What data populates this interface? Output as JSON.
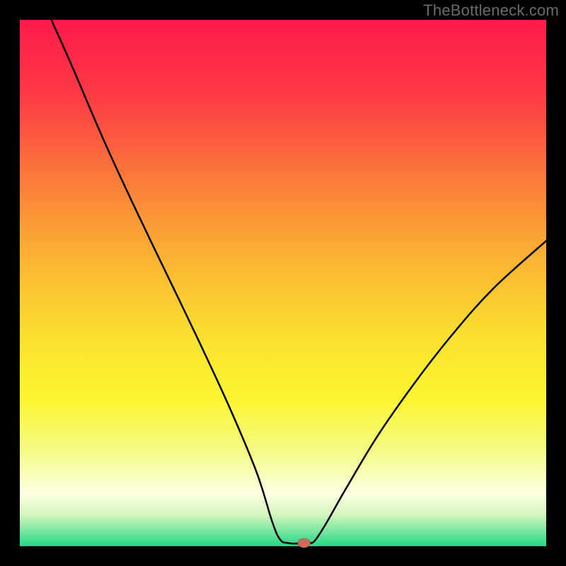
{
  "attribution": "TheBottleneck.com",
  "chart_data": {
    "type": "line",
    "title": "",
    "xlabel": "",
    "ylabel": "",
    "xlim": [
      0,
      100
    ],
    "ylim": [
      0,
      100
    ],
    "grid": false,
    "axes_visible": false,
    "background_gradient": {
      "stops": [
        {
          "pos": 0.0,
          "color": "#ff1a4b"
        },
        {
          "pos": 0.15,
          "color": "#fd3c44"
        },
        {
          "pos": 0.3,
          "color": "#fb7a3a"
        },
        {
          "pos": 0.45,
          "color": "#fbb233"
        },
        {
          "pos": 0.6,
          "color": "#fbe02f"
        },
        {
          "pos": 0.72,
          "color": "#fdf531"
        },
        {
          "pos": 0.82,
          "color": "#f4fb87"
        },
        {
          "pos": 0.9,
          "color": "#fdffe0"
        },
        {
          "pos": 0.94,
          "color": "#d4f6c0"
        },
        {
          "pos": 0.97,
          "color": "#7ee6a0"
        },
        {
          "pos": 1.0,
          "color": "#23d989"
        }
      ]
    },
    "series": [
      {
        "name": "bottleneck-curve",
        "points": [
          {
            "x": 6.0,
            "y": 100.0
          },
          {
            "x": 10.0,
            "y": 91.0
          },
          {
            "x": 16.0,
            "y": 77.0
          },
          {
            "x": 22.0,
            "y": 64.0
          },
          {
            "x": 28.0,
            "y": 51.5
          },
          {
            "x": 34.0,
            "y": 39.0
          },
          {
            "x": 40.0,
            "y": 26.0
          },
          {
            "x": 45.0,
            "y": 14.0
          },
          {
            "x": 48.0,
            "y": 4.5
          },
          {
            "x": 49.5,
            "y": 1.2
          },
          {
            "x": 51.0,
            "y": 0.6
          },
          {
            "x": 52.5,
            "y": 0.5
          },
          {
            "x": 54.0,
            "y": 0.5
          },
          {
            "x": 55.0,
            "y": 0.6
          },
          {
            "x": 56.0,
            "y": 1.0
          },
          {
            "x": 58.0,
            "y": 4.0
          },
          {
            "x": 62.0,
            "y": 11.0
          },
          {
            "x": 68.0,
            "y": 21.0
          },
          {
            "x": 75.0,
            "y": 31.0
          },
          {
            "x": 82.0,
            "y": 40.0
          },
          {
            "x": 90.0,
            "y": 49.0
          },
          {
            "x": 100.0,
            "y": 58.0
          }
        ]
      }
    ],
    "marker": {
      "name": "optimal-point",
      "x": 54.0,
      "y": 0.6,
      "color": "#d06a5c",
      "rx": 1.2,
      "ry": 0.9
    },
    "plot_area_frame_color": "#000000"
  }
}
